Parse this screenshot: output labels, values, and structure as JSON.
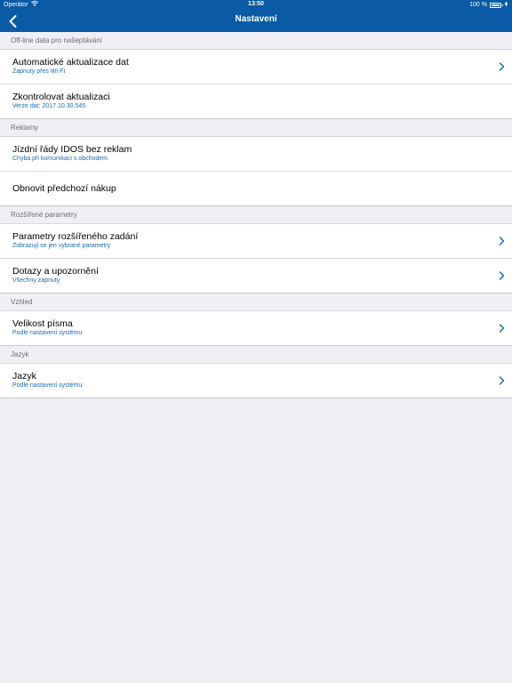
{
  "status_bar": {
    "carrier": "Operátor",
    "time": "13:50",
    "battery": "100 %"
  },
  "nav": {
    "title": "Nastavení"
  },
  "sections": [
    {
      "header": "Off-line data pro našeptávání",
      "rows": [
        {
          "title": "Automatické aktualizace dat",
          "subtitle": "Zapnuty přes Wi-Fi"
        },
        {
          "title": "Zkontrolovat aktualizaci",
          "subtitle": "Verze dat: 2017.10.30.545"
        }
      ]
    },
    {
      "header": "Reklamy",
      "rows": [
        {
          "title": "Jízdní řády IDOS bez reklam",
          "subtitle": "Chyba při komunikaci s obchodem"
        },
        {
          "title": "Obnovit předchozí nákup"
        }
      ]
    },
    {
      "header": "Rozšířené parametry",
      "rows": [
        {
          "title": "Parametry rozšířeného zadání",
          "subtitle": "Zobrazují se jen vybrané parametry"
        },
        {
          "title": "Dotazy a upozornění",
          "subtitle": "Všechny zapnuty"
        }
      ]
    },
    {
      "header": "Vzhled",
      "rows": [
        {
          "title": "Velikost písma",
          "subtitle": "Podle nastavení systému"
        }
      ]
    },
    {
      "header": "Jazyk",
      "rows": [
        {
          "title": "Jazyk",
          "subtitle": "Podle nastavení systému"
        }
      ]
    }
  ],
  "colors": {
    "nav_background": "#0a5aa6",
    "subtitle": "#1a6bb6",
    "page_background": "#efeff4"
  }
}
